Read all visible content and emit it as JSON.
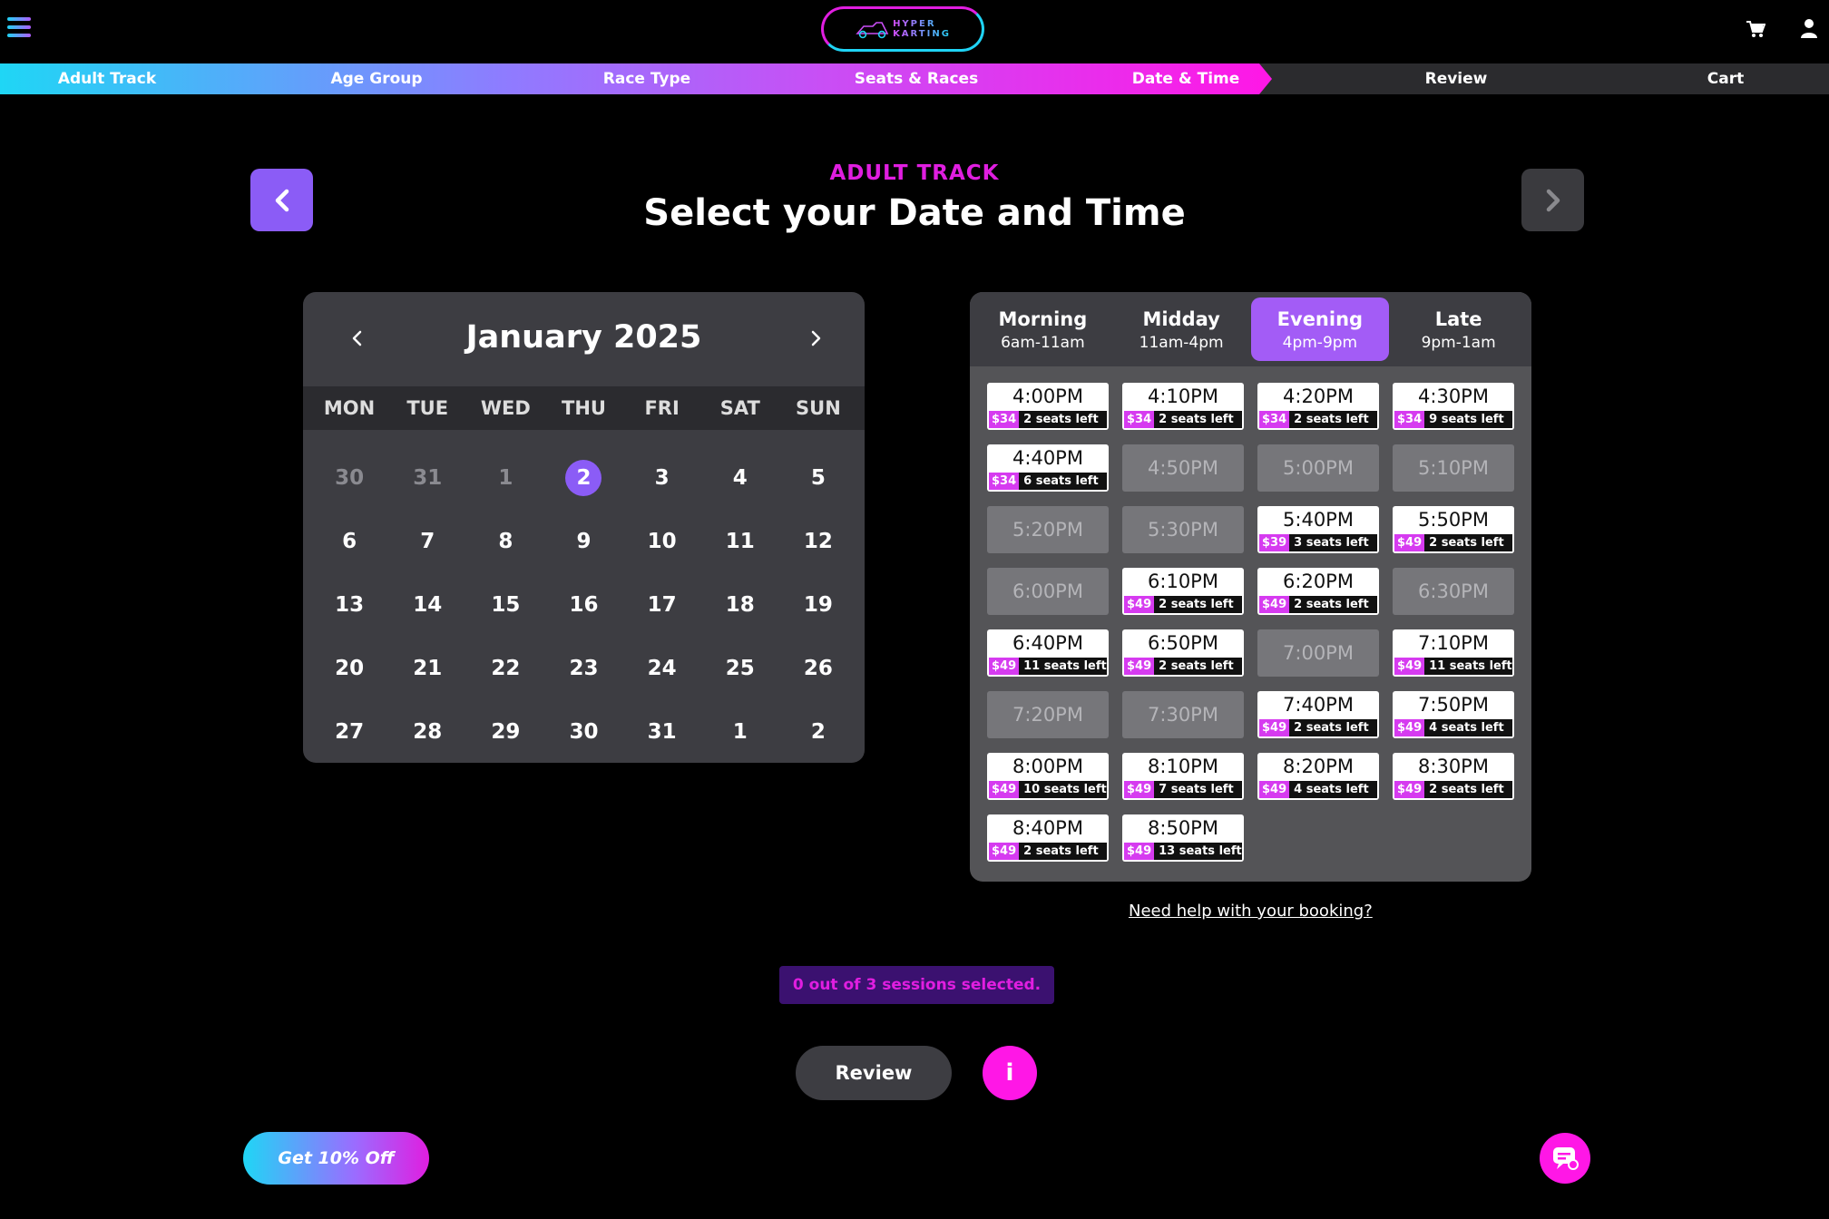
{
  "header": {
    "logo_text_line1": "HYPER",
    "logo_text_line2": "KARTING"
  },
  "steps": [
    {
      "label": "Adult Track"
    },
    {
      "label": "Age Group"
    },
    {
      "label": "Race Type"
    },
    {
      "label": "Seats & Races"
    },
    {
      "label": "Date & Time"
    },
    {
      "label": "Review"
    },
    {
      "label": "Cart"
    }
  ],
  "active_step": "Date & Time",
  "page": {
    "kicker": "ADULT TRACK",
    "title": "Select your Date and Time"
  },
  "calendar": {
    "month_label": "January 2025",
    "weekdays": [
      "MON",
      "TUE",
      "WED",
      "THU",
      "FRI",
      "SAT",
      "SUN"
    ],
    "days": [
      {
        "d": "30",
        "muted": true
      },
      {
        "d": "31",
        "muted": true
      },
      {
        "d": "1",
        "muted": true
      },
      {
        "d": "2",
        "selected": true
      },
      {
        "d": "3"
      },
      {
        "d": "4"
      },
      {
        "d": "5"
      },
      {
        "d": "6"
      },
      {
        "d": "7"
      },
      {
        "d": "8"
      },
      {
        "d": "9"
      },
      {
        "d": "10"
      },
      {
        "d": "11"
      },
      {
        "d": "12"
      },
      {
        "d": "13"
      },
      {
        "d": "14"
      },
      {
        "d": "15"
      },
      {
        "d": "16"
      },
      {
        "d": "17"
      },
      {
        "d": "18"
      },
      {
        "d": "19"
      },
      {
        "d": "20"
      },
      {
        "d": "21"
      },
      {
        "d": "22"
      },
      {
        "d": "23"
      },
      {
        "d": "24"
      },
      {
        "d": "25"
      },
      {
        "d": "26"
      },
      {
        "d": "27"
      },
      {
        "d": "28"
      },
      {
        "d": "29"
      },
      {
        "d": "30"
      },
      {
        "d": "31"
      },
      {
        "d": "1"
      },
      {
        "d": "2"
      }
    ]
  },
  "periods": [
    {
      "name": "Morning",
      "range": "6am-11am"
    },
    {
      "name": "Midday",
      "range": "11am-4pm"
    },
    {
      "name": "Evening",
      "range": "4pm-9pm",
      "active": true
    },
    {
      "name": "Late",
      "range": "9pm-1am"
    }
  ],
  "slots": [
    {
      "time": "4:00PM",
      "price": "$34",
      "seats": "2 seats left"
    },
    {
      "time": "4:10PM",
      "price": "$34",
      "seats": "2 seats left"
    },
    {
      "time": "4:20PM",
      "price": "$34",
      "seats": "2 seats left"
    },
    {
      "time": "4:30PM",
      "price": "$34",
      "seats": "9 seats left"
    },
    {
      "time": "4:40PM",
      "price": "$34",
      "seats": "6 seats left"
    },
    {
      "time": "4:50PM"
    },
    {
      "time": "5:00PM"
    },
    {
      "time": "5:10PM"
    },
    {
      "time": "5:20PM"
    },
    {
      "time": "5:30PM"
    },
    {
      "time": "5:40PM",
      "price": "$39",
      "seats": "3 seats left"
    },
    {
      "time": "5:50PM",
      "price": "$49",
      "seats": "2 seats left"
    },
    {
      "time": "6:00PM"
    },
    {
      "time": "6:10PM",
      "price": "$49",
      "seats": "2 seats left"
    },
    {
      "time": "6:20PM",
      "price": "$49",
      "seats": "2 seats left"
    },
    {
      "time": "6:30PM"
    },
    {
      "time": "6:40PM",
      "price": "$49",
      "seats": "11 seats left"
    },
    {
      "time": "6:50PM",
      "price": "$49",
      "seats": "2 seats left"
    },
    {
      "time": "7:00PM"
    },
    {
      "time": "7:10PM",
      "price": "$49",
      "seats": "11 seats left"
    },
    {
      "time": "7:20PM"
    },
    {
      "time": "7:30PM"
    },
    {
      "time": "7:40PM",
      "price": "$49",
      "seats": "2 seats left"
    },
    {
      "time": "7:50PM",
      "price": "$49",
      "seats": "4 seats left"
    },
    {
      "time": "8:00PM",
      "price": "$49",
      "seats": "10 seats left"
    },
    {
      "time": "8:10PM",
      "price": "$49",
      "seats": "7 seats left"
    },
    {
      "time": "8:20PM",
      "price": "$49",
      "seats": "4 seats left"
    },
    {
      "time": "8:30PM",
      "price": "$49",
      "seats": "2 seats left"
    },
    {
      "time": "8:40PM",
      "price": "$49",
      "seats": "2 seats left"
    },
    {
      "time": "8:50PM",
      "price": "$49",
      "seats": "13 seats left"
    }
  ],
  "help_link": "Need help with your booking?",
  "sessions_status": "0 out of 3 sessions selected.",
  "buttons": {
    "review": "Review",
    "info": "i",
    "discount": "Get 10% Off"
  },
  "icons": {
    "menu": "hamburger-icon",
    "cart": "cart-icon",
    "user": "user-icon",
    "prev": "chevron-left-icon",
    "next": "chevron-right-icon",
    "chat": "chat-icon"
  },
  "colors": {
    "accent_purple": "#8b5cf6",
    "accent_magenta": "#ff17e6",
    "accent_cyan": "#1fd6f5"
  }
}
